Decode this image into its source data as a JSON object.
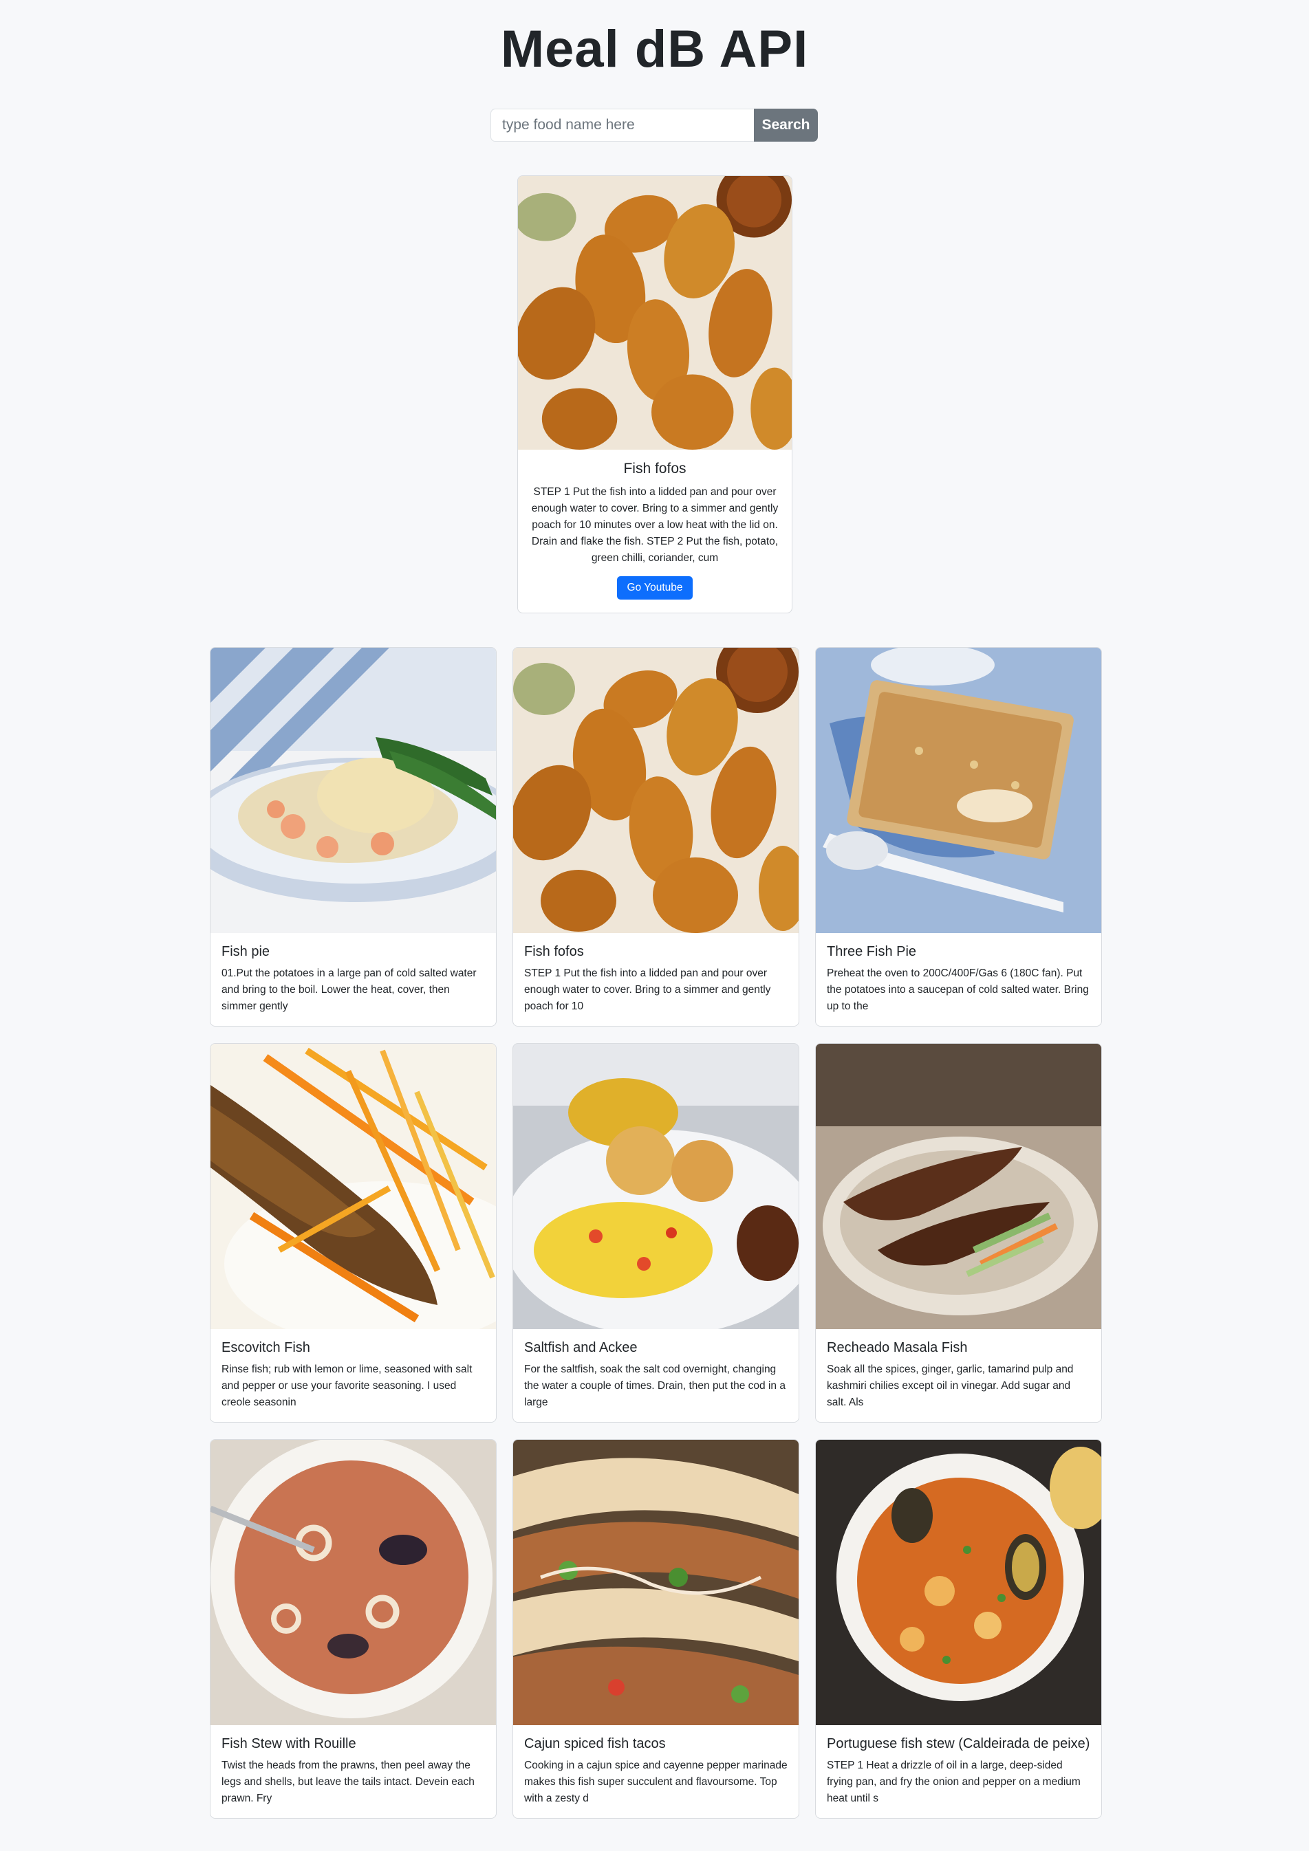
{
  "header": {
    "title": "Meal dB API"
  },
  "search": {
    "placeholder": "type food name here",
    "button_label": "Search"
  },
  "featured": {
    "title": "Fish fofos",
    "text": "STEP 1 Put the fish into a lidded pan and pour over enough water to cover. Bring to a simmer and gently poach for 10 minutes over a low heat with the lid on. Drain and flake the fish. STEP 2 Put the fish, potato, green chilli, coriander, cum",
    "button_label": "Go Youtube",
    "image": "fish-fofos-photo"
  },
  "meals": [
    {
      "title": "Fish pie",
      "text": "01.Put the potatoes in a large pan of cold salted water and bring to the boil. Lower the heat, cover, then simmer gently",
      "image": "fish-pie-photo"
    },
    {
      "title": "Fish fofos",
      "text": "STEP 1 Put the fish into a lidded pan and pour over enough water to cover. Bring to a simmer and gently poach for 10",
      "image": "fish-fofos-photo"
    },
    {
      "title": "Three Fish Pie",
      "text": "Preheat the oven to 200C/400F/Gas 6 (180C fan). Put the potatoes into a saucepan of cold salted water. Bring up to the",
      "image": "three-fish-pie-photo"
    },
    {
      "title": "Escovitch Fish",
      "text": "Rinse fish; rub with lemon or lime, seasoned with salt and pepper or use your favorite seasoning. I used creole seasonin",
      "image": "escovitch-fish-photo"
    },
    {
      "title": "Saltfish and Ackee",
      "text": "For the saltfish, soak the salt cod overnight, changing the water a couple of times. Drain, then put the cod in a large",
      "image": "saltfish-ackee-photo"
    },
    {
      "title": "Recheado Masala Fish",
      "text": "Soak all the spices, ginger, garlic, tamarind pulp and kashmiri chilies except oil in vinegar. Add sugar and salt. Als",
      "image": "recheado-masala-fish-photo"
    },
    {
      "title": "Fish Stew with Rouille",
      "text": "Twist the heads from the prawns, then peel away the legs and shells, but leave the tails intact. Devein each prawn. Fry",
      "image": "fish-stew-rouille-photo"
    },
    {
      "title": "Cajun spiced fish tacos",
      "text": "Cooking in a cajun spice and cayenne pepper marinade makes this fish super succulent and flavoursome. Top with a zesty d",
      "image": "cajun-fish-tacos-photo"
    },
    {
      "title": "Portuguese fish stew (Caldeirada de peixe)",
      "text": "STEP 1 Heat a drizzle of oil in a large, deep-sided frying pan, and fry the onion and pepper on a medium heat until s",
      "image": "portuguese-fish-stew-photo"
    }
  ],
  "colors": {
    "primary": "#0d6efd",
    "secondary": "#6c757d",
    "background": "#f7f8fa"
  }
}
